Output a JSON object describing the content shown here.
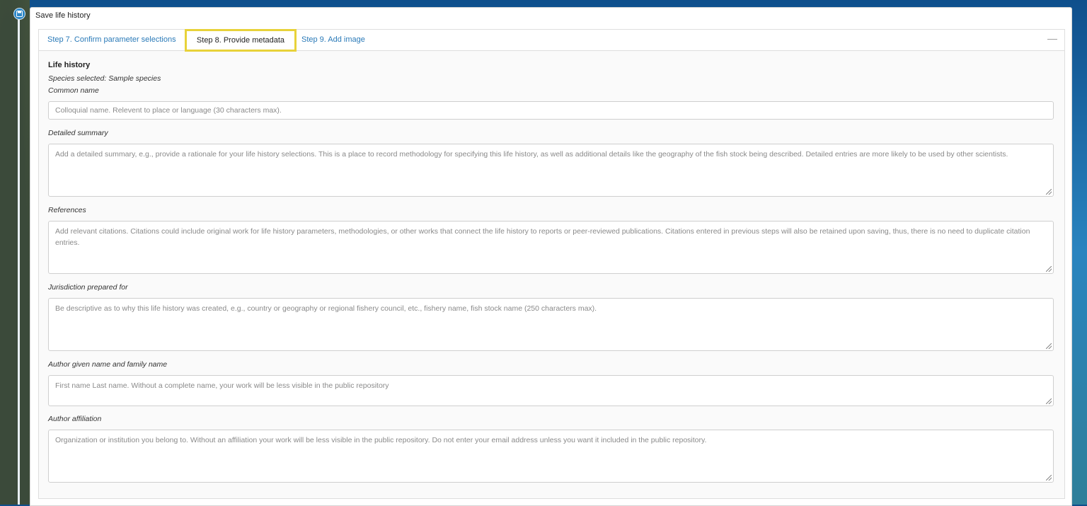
{
  "window": {
    "title": "Save life history"
  },
  "tabs": [
    {
      "label": "Step 7. Confirm parameter selections",
      "active": false
    },
    {
      "label": "Step 8. Provide metadata",
      "active": true
    },
    {
      "label": "Step 9. Add image",
      "active": false
    }
  ],
  "collapse_glyph": "—",
  "section": {
    "title": "Life history",
    "species_selected": "Species selected: Sample species"
  },
  "fields": {
    "common_name": {
      "label": "Common name",
      "placeholder": "Colloquial name. Relevent to place or language (30 characters max)."
    },
    "detailed_summary": {
      "label": "Detailed summary",
      "placeholder": "Add a detailed summary, e.g., provide a rationale for your life history selections. This is a place to record methodology for specifying this life history, as well as additional details like the geography of the fish stock being described. Detailed entries are more likely to be used by other scientists."
    },
    "references": {
      "label": "References",
      "placeholder": "Add relevant citations. Citations could include original work for life history parameters, methodologies, or other works that connect the life history to reports or peer-reviewed publications. Citations entered in previous steps will also be retained upon saving, thus, there is no need to duplicate citation entries."
    },
    "jurisdiction": {
      "label": "Jurisdiction prepared for",
      "placeholder": "Be descriptive as to why this life history was created, e.g., country or geography or regional fishery council, etc., fishery name, fish stock name (250 characters max)."
    },
    "author_name": {
      "label": "Author given name and family name",
      "placeholder": "First name Last name. Without a complete name, your work will be less visible in the public repository"
    },
    "author_affiliation": {
      "label": "Author affiliation",
      "placeholder": "Organization or institution you belong to. Without an affiliation your work will be less visible in the public repository. Do not enter your email address unless you want it included in the public repository."
    }
  },
  "colors": {
    "tab_link": "#2a7ab8",
    "active_tab_highlight": "#e8d23a",
    "panel_bg": "#ffffff"
  },
  "icons": {
    "rail_icon": "save-icon"
  }
}
